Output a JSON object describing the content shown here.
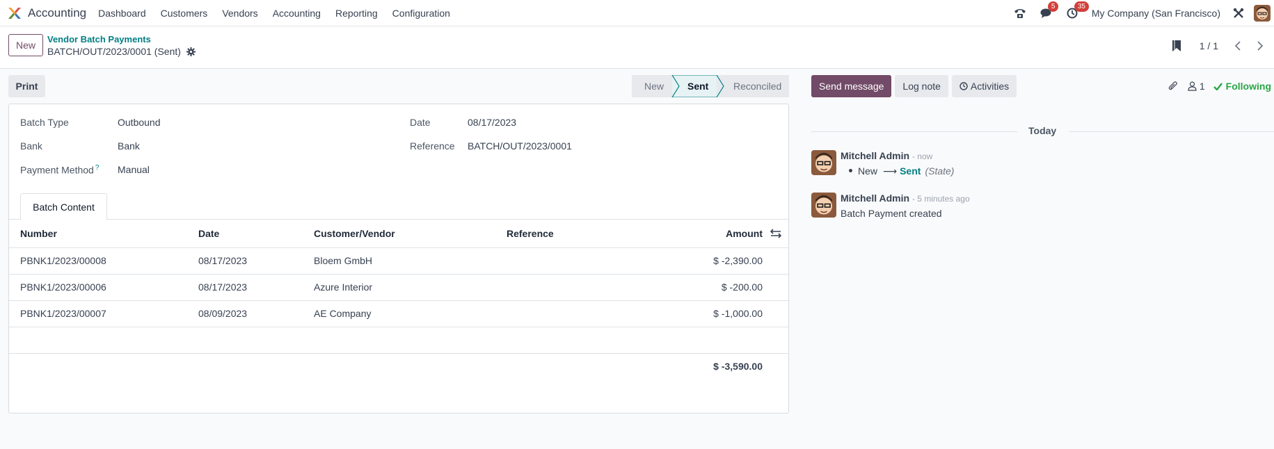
{
  "navbar": {
    "app_title": "Accounting",
    "menu": [
      "Dashboard",
      "Customers",
      "Vendors",
      "Accounting",
      "Reporting",
      "Configuration"
    ],
    "messages_badge": "5",
    "activities_badge": "35",
    "company": "My Company (San Francisco)"
  },
  "control_panel": {
    "new_label": "New",
    "breadcrumb_parent": "Vendor Batch Payments",
    "breadcrumb_current": "BATCH/OUT/2023/0001 (Sent)",
    "pager": "1 / 1"
  },
  "form": {
    "print_label": "Print",
    "stages": [
      "New",
      "Sent",
      "Reconciled"
    ],
    "active_stage": "Sent",
    "fields": {
      "batch_type_label": "Batch Type",
      "batch_type_value": "Outbound",
      "bank_label": "Bank",
      "bank_value": "Bank",
      "payment_method_label": "Payment Method",
      "payment_method_help": "?",
      "payment_method_value": "Manual",
      "date_label": "Date",
      "date_value": "08/17/2023",
      "reference_label": "Reference",
      "reference_value": "BATCH/OUT/2023/0001"
    },
    "tab_label": "Batch Content",
    "table": {
      "headers": [
        "Number",
        "Date",
        "Customer/Vendor",
        "Reference",
        "Amount"
      ],
      "rows": [
        {
          "number": "PBNK1/2023/00008",
          "date": "08/17/2023",
          "partner": "Bloem GmbH",
          "reference": "",
          "amount": "$ -2,390.00"
        },
        {
          "number": "PBNK1/2023/00006",
          "date": "08/17/2023",
          "partner": "Azure Interior",
          "reference": "",
          "amount": "$ -200.00"
        },
        {
          "number": "PBNK1/2023/00007",
          "date": "08/09/2023",
          "partner": "AE Company",
          "reference": "",
          "amount": "$ -1,000.00"
        }
      ],
      "total": "$ -3,590.00"
    }
  },
  "chatter": {
    "send_message": "Send message",
    "log_note": "Log note",
    "activities": "Activities",
    "followers_count": "1",
    "following": "Following",
    "separator": "Today",
    "messages": [
      {
        "author": "Mitchell Admin",
        "when": "- now",
        "from_state": "New",
        "to_state": "Sent",
        "field": "(State)"
      },
      {
        "author": "Mitchell Admin",
        "when": "- 5 minutes ago",
        "body": "Batch Payment created"
      }
    ]
  },
  "colors": {
    "brand": "#714b67",
    "link": "#017e84",
    "badge": "#d23f3a",
    "following": "#28a745"
  }
}
